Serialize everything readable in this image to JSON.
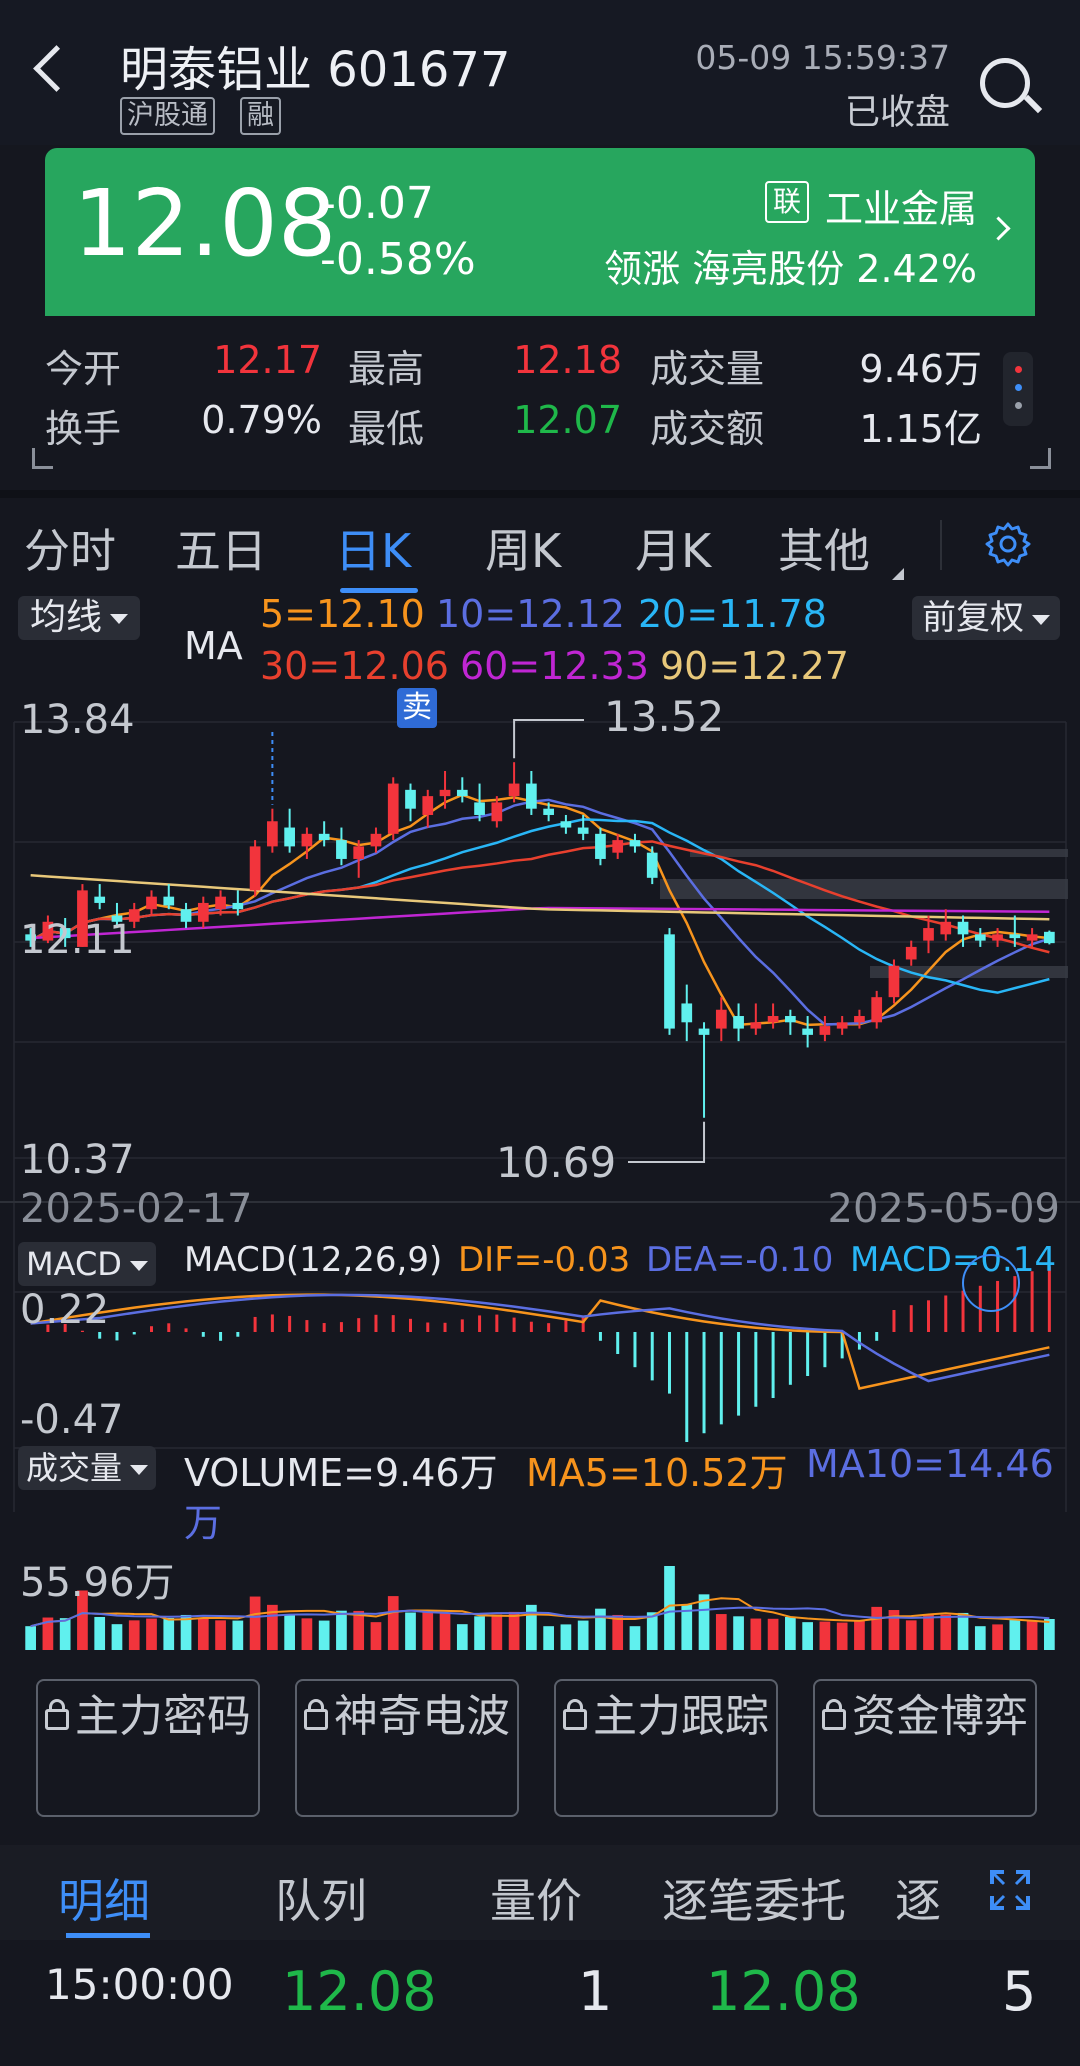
{
  "header": {
    "title": "明泰铝业 601677",
    "tags": [
      "沪股通",
      "融"
    ],
    "datetime": "05-09 15:59:37",
    "market_status": "已收盘"
  },
  "quote": {
    "price": "12.08",
    "change": "-0.07",
    "change_pct": "-0.58%",
    "industry_tag": "联",
    "industry": "工业金属",
    "leader": "领涨 海亮股份 2.42%"
  },
  "stats": [
    {
      "label": "今开",
      "value": "12.17"
    },
    {
      "label": "最高",
      "value": "12.18"
    },
    {
      "label": "成交量",
      "value": "9.46万"
    },
    {
      "label": "换手",
      "value": "0.79%"
    },
    {
      "label": "最低",
      "value": "12.07"
    },
    {
      "label": "成交额",
      "value": "1.15亿"
    }
  ],
  "tabs": [
    "分时",
    "五日",
    "日K",
    "周K",
    "月K",
    "其他"
  ],
  "active_tab": "日K",
  "chart_data": {
    "type": "candlestick",
    "main_selector": "均线",
    "adjust": "前复权",
    "ma_label": "MA",
    "ma": [
      {
        "name": "5=12.10",
        "color": "#f7941d"
      },
      {
        "name": "10=12.12",
        "color": "#5b6ee1"
      },
      {
        "name": "20=11.78",
        "color": "#29b6f6"
      },
      {
        "name": "30=12.06",
        "color": "#e8402e"
      },
      {
        "name": "60=12.33",
        "color": "#c026d3"
      },
      {
        "name": "90=12.27",
        "color": "#e8c87a"
      }
    ],
    "y_top": "13.84",
    "y_mid": "12.11",
    "y_bottom": "10.37",
    "ylim": [
      10.37,
      13.84
    ],
    "max_marker": "13.52",
    "min_marker": "10.69",
    "sell_marker": "卖",
    "x_start": "2025-02-17",
    "x_end": "2025-05-09",
    "candles": [
      [
        12.15,
        12.2,
        12.05,
        12.1
      ],
      [
        12.1,
        12.3,
        12.08,
        12.25
      ],
      [
        12.2,
        12.28,
        12.05,
        12.12
      ],
      [
        12.05,
        12.55,
        12.05,
        12.5
      ],
      [
        12.45,
        12.55,
        12.35,
        12.4
      ],
      [
        12.3,
        12.4,
        12.2,
        12.25
      ],
      [
        12.25,
        12.4,
        12.2,
        12.35
      ],
      [
        12.35,
        12.5,
        12.3,
        12.45
      ],
      [
        12.45,
        12.55,
        12.35,
        12.38
      ],
      [
        12.35,
        12.4,
        12.2,
        12.25
      ],
      [
        12.25,
        12.45,
        12.2,
        12.4
      ],
      [
        12.35,
        12.5,
        12.3,
        12.45
      ],
      [
        12.4,
        12.5,
        12.3,
        12.35
      ],
      [
        12.5,
        12.9,
        12.45,
        12.85
      ],
      [
        12.85,
        13.15,
        12.8,
        13.05
      ],
      [
        13.0,
        13.15,
        12.8,
        12.85
      ],
      [
        12.85,
        13.0,
        12.75,
        12.95
      ],
      [
        12.95,
        13.05,
        12.85,
        12.9
      ],
      [
        12.9,
        13.0,
        12.7,
        12.75
      ],
      [
        12.75,
        12.9,
        12.6,
        12.85
      ],
      [
        12.85,
        13.0,
        12.8,
        12.95
      ],
      [
        12.95,
        13.4,
        12.9,
        13.35
      ],
      [
        13.3,
        13.35,
        13.05,
        13.15
      ],
      [
        13.1,
        13.3,
        13.0,
        13.25
      ],
      [
        13.25,
        13.45,
        13.15,
        13.3
      ],
      [
        13.3,
        13.4,
        13.2,
        13.25
      ],
      [
        13.2,
        13.35,
        13.05,
        13.1
      ],
      [
        13.05,
        13.25,
        13.0,
        13.2
      ],
      [
        13.25,
        13.52,
        13.2,
        13.35
      ],
      [
        13.35,
        13.45,
        13.1,
        13.15
      ],
      [
        13.15,
        13.2,
        13.05,
        13.1
      ],
      [
        13.05,
        13.1,
        12.95,
        13.0
      ],
      [
        13.0,
        13.1,
        12.9,
        12.95
      ],
      [
        12.95,
        13.0,
        12.7,
        12.75
      ],
      [
        12.8,
        12.95,
        12.75,
        12.9
      ],
      [
        12.9,
        12.95,
        12.8,
        12.85
      ],
      [
        12.8,
        12.85,
        12.55,
        12.6
      ],
      [
        12.15,
        12.2,
        11.35,
        11.4
      ],
      [
        11.6,
        11.75,
        11.3,
        11.45
      ],
      [
        11.4,
        11.45,
        10.69,
        11.35
      ],
      [
        11.4,
        11.65,
        11.3,
        11.55
      ],
      [
        11.5,
        11.6,
        11.3,
        11.4
      ],
      [
        11.4,
        11.6,
        11.35,
        11.45
      ],
      [
        11.45,
        11.6,
        11.4,
        11.5
      ],
      [
        11.5,
        11.55,
        11.35,
        11.45
      ],
      [
        11.4,
        11.5,
        11.25,
        11.35
      ],
      [
        11.35,
        11.5,
        11.3,
        11.42
      ],
      [
        11.4,
        11.5,
        11.35,
        11.45
      ],
      [
        11.45,
        11.55,
        11.4,
        11.5
      ],
      [
        11.45,
        11.7,
        11.4,
        11.65
      ],
      [
        11.65,
        11.95,
        11.6,
        11.9
      ],
      [
        11.95,
        12.1,
        11.9,
        12.05
      ],
      [
        12.1,
        12.3,
        12.0,
        12.2
      ],
      [
        12.15,
        12.35,
        12.1,
        12.25
      ],
      [
        12.25,
        12.3,
        12.05,
        12.15
      ],
      [
        12.15,
        12.2,
        12.05,
        12.1
      ],
      [
        12.1,
        12.2,
        12.05,
        12.15
      ],
      [
        12.15,
        12.3,
        12.05,
        12.12
      ],
      [
        12.1,
        12.2,
        12.05,
        12.15
      ],
      [
        12.17,
        12.18,
        12.07,
        12.08
      ]
    ]
  },
  "macd": {
    "selector": "MACD",
    "label": "MACD(12,26,9)",
    "dif": "DIF=-0.03",
    "dea": "DEA=-0.10",
    "macd": "MACD=0.14",
    "y_top": "0.22",
    "y_bottom": "-0.47"
  },
  "volume": {
    "selector": "成交量",
    "label": "VOLUME=9.46万",
    "ma5": "MA5=10.52万",
    "ma10": "MA10=14.46",
    "ma10_wrap": "万",
    "y_top": "55.96万"
  },
  "feature_buttons": [
    "主力密码",
    "神奇电波",
    "主力跟踪",
    "资金博弈"
  ],
  "bottom_tabs": [
    "明细",
    "队列",
    "量价",
    "逐笔委托",
    "逐"
  ],
  "trade_row": {
    "time": "15:00:00",
    "price": "12.08",
    "volume": "1",
    "price2": "12.08",
    "count": "5"
  },
  "colors": {
    "up": "#f2343c",
    "down": "#60f0ee",
    "accent": "#3e8ef7",
    "price_box": "#27a65e"
  }
}
